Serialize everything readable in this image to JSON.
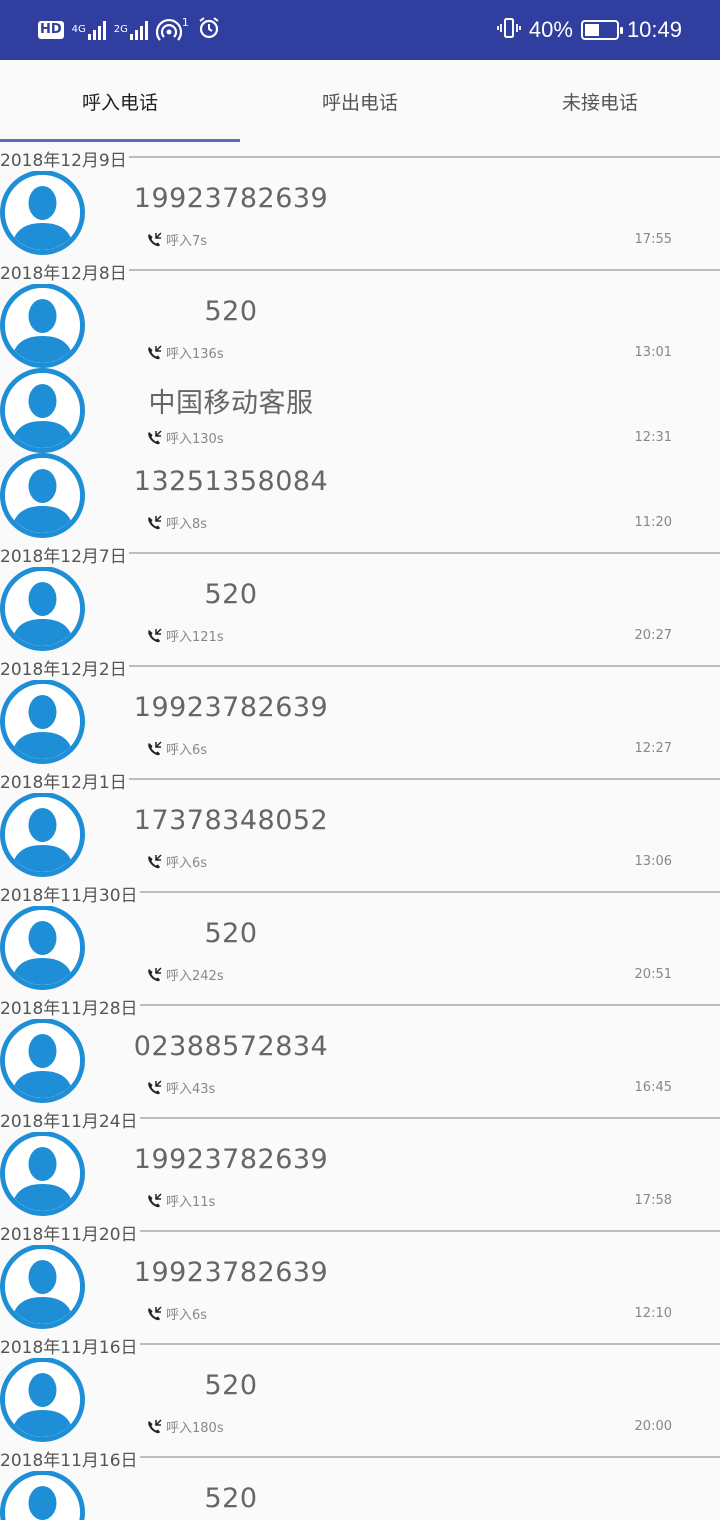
{
  "status_bar": {
    "hd": "HD",
    "net1": "4G",
    "net2": "2G",
    "hotspot_count": "1",
    "battery": "40%",
    "time": "10:49"
  },
  "tabs": [
    {
      "label": "呼入电话",
      "active": true
    },
    {
      "label": "呼出电话",
      "active": false
    },
    {
      "label": "未接电话",
      "active": false
    }
  ],
  "groups": [
    {
      "date": "2018年12月9日",
      "calls": [
        {
          "number": "19923782639",
          "type": "呼入7s",
          "time": "17:55"
        }
      ]
    },
    {
      "date": "2018年12月8日",
      "calls": [
        {
          "number": "520",
          "type": "呼入136s",
          "time": "13:01"
        },
        {
          "number": "中国移动客服",
          "type": "呼入130s",
          "time": "12:31"
        },
        {
          "number": "13251358084",
          "type": "呼入8s",
          "time": "11:20"
        }
      ]
    },
    {
      "date": "2018年12月7日",
      "calls": [
        {
          "number": "520",
          "type": "呼入121s",
          "time": "20:27"
        }
      ]
    },
    {
      "date": "2018年12月2日",
      "calls": [
        {
          "number": "19923782639",
          "type": "呼入6s",
          "time": "12:27"
        }
      ]
    },
    {
      "date": "2018年12月1日",
      "calls": [
        {
          "number": "17378348052",
          "type": "呼入6s",
          "time": "13:06"
        }
      ]
    },
    {
      "date": "2018年11月30日",
      "calls": [
        {
          "number": "520",
          "type": "呼入242s",
          "time": "20:51"
        }
      ]
    },
    {
      "date": "2018年11月28日",
      "calls": [
        {
          "number": "02388572834",
          "type": "呼入43s",
          "time": "16:45"
        }
      ]
    },
    {
      "date": "2018年11月24日",
      "calls": [
        {
          "number": "19923782639",
          "type": "呼入11s",
          "time": "17:58"
        }
      ]
    },
    {
      "date": "2018年11月20日",
      "calls": [
        {
          "number": "19923782639",
          "type": "呼入6s",
          "time": "12:10"
        }
      ]
    },
    {
      "date": "2018年11月16日",
      "calls": [
        {
          "number": "520",
          "type": "呼入180s",
          "time": "20:00"
        }
      ]
    },
    {
      "date": "2018年11月16日",
      "calls": [
        {
          "number": "520",
          "type": "",
          "time": ""
        }
      ]
    }
  ],
  "colors": {
    "status_bar": "#303f9f",
    "tab_indicator": "#5c6bc0",
    "avatar": "#1e8fd6"
  },
  "icons": {
    "avatar": "person-avatar-icon",
    "call_type": "incoming-call-icon"
  }
}
